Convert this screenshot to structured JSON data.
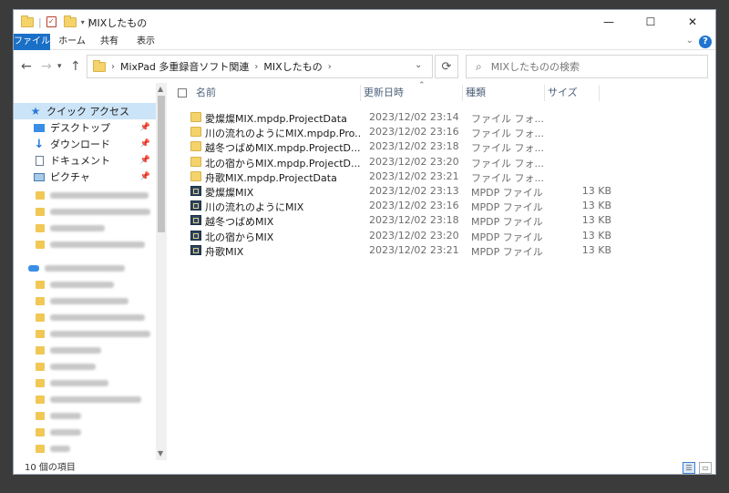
{
  "window": {
    "title": "MIXしたもの",
    "controls": {
      "minimize": "—",
      "maximize": "☐",
      "close": "✕"
    }
  },
  "ribbon": {
    "tabs": [
      {
        "label": "ファイル"
      },
      {
        "label": "ホーム"
      },
      {
        "label": "共有"
      },
      {
        "label": "表示"
      }
    ],
    "help": "?"
  },
  "address": {
    "crumbs": [
      "MixPad 多重録音ソフト関連",
      "MIXしたもの"
    ],
    "separator": "›",
    "refresh": "⟳"
  },
  "search": {
    "placeholder": "MIXしたものの検索"
  },
  "navpane": {
    "quick_access": "クイック アクセス",
    "items": [
      {
        "label": "デスクトップ"
      },
      {
        "label": "ダウンロード"
      },
      {
        "label": "ドキュメント"
      },
      {
        "label": "ピクチャ"
      }
    ]
  },
  "columns": {
    "name": "名前",
    "date": "更新日時",
    "type": "種類",
    "size": "サイズ"
  },
  "files": [
    {
      "name": "愛燦燦MIX.mpdp.ProjectData",
      "date": "2023/12/02 23:14",
      "type": "ファイル フォ...",
      "size": "",
      "icon": "folder-icon"
    },
    {
      "name": "川の流れのようにMIX.mpdp.Pro...",
      "date": "2023/12/02 23:16",
      "type": "ファイル フォ...",
      "size": "",
      "icon": "folder-icon"
    },
    {
      "name": "越冬つばめMIX.mpdp.ProjectD...",
      "date": "2023/12/02 23:18",
      "type": "ファイル フォ...",
      "size": "",
      "icon": "folder-icon"
    },
    {
      "name": "北の宿からMIX.mpdp.ProjectD...",
      "date": "2023/12/02 23:20",
      "type": "ファイル フォ...",
      "size": "",
      "icon": "folder-icon"
    },
    {
      "name": "舟歌MIX.mpdp.ProjectData",
      "date": "2023/12/02 23:21",
      "type": "ファイル フォ...",
      "size": "",
      "icon": "folder-icon"
    },
    {
      "name": "愛燦燦MIX",
      "date": "2023/12/02 23:13",
      "type": "MPDP ファイル",
      "size": "13 KB",
      "icon": "mpdp-file-icon"
    },
    {
      "name": "川の流れのようにMIX",
      "date": "2023/12/02 23:16",
      "type": "MPDP ファイル",
      "size": "13 KB",
      "icon": "mpdp-file-icon"
    },
    {
      "name": "越冬つばめMIX",
      "date": "2023/12/02 23:18",
      "type": "MPDP ファイル",
      "size": "13 KB",
      "icon": "mpdp-file-icon"
    },
    {
      "name": "北の宿からMIX",
      "date": "2023/12/02 23:20",
      "type": "MPDP ファイル",
      "size": "13 KB",
      "icon": "mpdp-file-icon"
    },
    {
      "name": "舟歌MIX",
      "date": "2023/12/02 23:21",
      "type": "MPDP ファイル",
      "size": "13 KB",
      "icon": "mpdp-file-icon"
    }
  ],
  "status": {
    "count": "10 個の項目"
  }
}
